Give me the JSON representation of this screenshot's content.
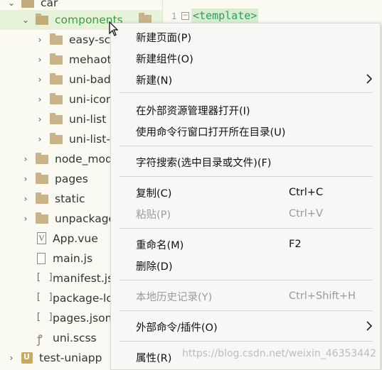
{
  "tree": {
    "items": [
      {
        "label": "car",
        "type": "folder-open",
        "indent": 0
      },
      {
        "label": "components",
        "type": "folder-open",
        "indent": 1,
        "selected": true
      },
      {
        "label": "easy-scro",
        "type": "folder",
        "indent": 2
      },
      {
        "label": "mehaotia",
        "type": "folder",
        "indent": 2
      },
      {
        "label": "uni-badg",
        "type": "folder",
        "indent": 2
      },
      {
        "label": "uni-icons",
        "type": "folder",
        "indent": 2
      },
      {
        "label": "uni-list",
        "type": "folder",
        "indent": 2
      },
      {
        "label": "uni-list-it",
        "type": "folder",
        "indent": 2
      },
      {
        "label": "node_modu",
        "type": "folder",
        "indent": 1
      },
      {
        "label": "pages",
        "type": "folder",
        "indent": 1
      },
      {
        "label": "static",
        "type": "folder",
        "indent": 1
      },
      {
        "label": "unpackage",
        "type": "folder",
        "indent": 1
      },
      {
        "label": "App.vue",
        "type": "vue",
        "indent": 1
      },
      {
        "label": "main.js",
        "type": "page",
        "indent": 1
      },
      {
        "label": "manifest.jso",
        "type": "bracket",
        "indent": 1
      },
      {
        "label": "package-lo",
        "type": "bracket",
        "indent": 1
      },
      {
        "label": "pages.json",
        "type": "bracket",
        "indent": 1
      },
      {
        "label": "uni.scss",
        "type": "scss",
        "indent": 1
      },
      {
        "label": "test-uniapp",
        "type": "project",
        "indent": 0
      }
    ]
  },
  "editor": {
    "line_number": "1",
    "fold_marker": "⊟",
    "code": "<template>"
  },
  "context_menu": {
    "items": [
      {
        "label": "新建页面(P)",
        "shortcut": "",
        "disabled": false,
        "submenu": false
      },
      {
        "label": "新建组件(O)",
        "shortcut": "",
        "disabled": false,
        "submenu": false
      },
      {
        "label": "新建(N)",
        "shortcut": "",
        "disabled": false,
        "submenu": true
      },
      {
        "label": "在外部资源管理器打开(I)",
        "shortcut": "",
        "disabled": false,
        "submenu": false
      },
      {
        "label": "使用命令行窗口打开所在目录(U)",
        "shortcut": "",
        "disabled": false,
        "submenu": false
      },
      {
        "label": "字符搜索(选中目录或文件)(F)",
        "shortcut": "",
        "disabled": false,
        "submenu": false
      },
      {
        "label": "复制(C)",
        "shortcut": "Ctrl+C",
        "disabled": false,
        "submenu": false
      },
      {
        "label": "粘贴(P)",
        "shortcut": "Ctrl+V",
        "disabled": true,
        "submenu": false
      },
      {
        "label": "重命名(M)",
        "shortcut": "F2",
        "disabled": false,
        "submenu": false
      },
      {
        "label": "删除(D)",
        "shortcut": "",
        "disabled": false,
        "submenu": false
      },
      {
        "label": "本地历史记录(Y)",
        "shortcut": "Ctrl+Shift+H",
        "disabled": true,
        "submenu": false
      },
      {
        "label": "外部命令/插件(O)",
        "shortcut": "",
        "disabled": false,
        "submenu": true
      },
      {
        "label": "属性(R)",
        "shortcut": "",
        "disabled": false,
        "submenu": false
      }
    ]
  },
  "watermark": "https://blog.csdn.net/weixin_46353442",
  "colors": {
    "selected_bg": "#e6f3d9",
    "selected_text": "#3a9e44",
    "menu_bg": "#f7f7f5",
    "disabled_text": "#9a9a9a"
  }
}
